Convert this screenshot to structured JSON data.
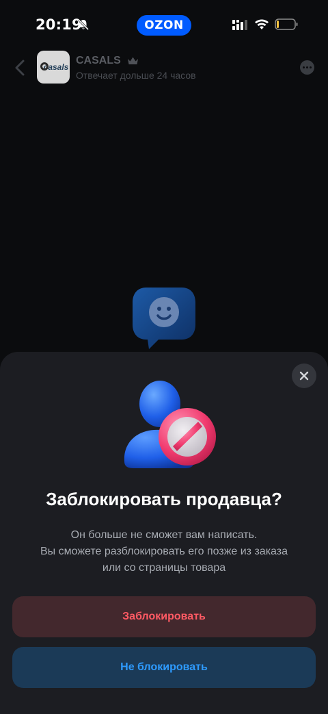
{
  "status_bar": {
    "time": "20:19",
    "brand": "OZON",
    "brand_color": "#005bff"
  },
  "chat_header": {
    "avatar_text": "casals",
    "seller_name": "CASALS",
    "seller_status": "Отвечает дольше 24 часов"
  },
  "modal": {
    "title": "Заблокировать продавца?",
    "description_lines": [
      "Он больше не сможет вам написать.",
      "Вы сможете разблокировать его позже из заказа",
      "или со страницы товара"
    ],
    "block_button": "Заблокировать",
    "cancel_button": "Не блокировать",
    "block_color": "#ff5a64",
    "cancel_color": "#2e9bff"
  }
}
